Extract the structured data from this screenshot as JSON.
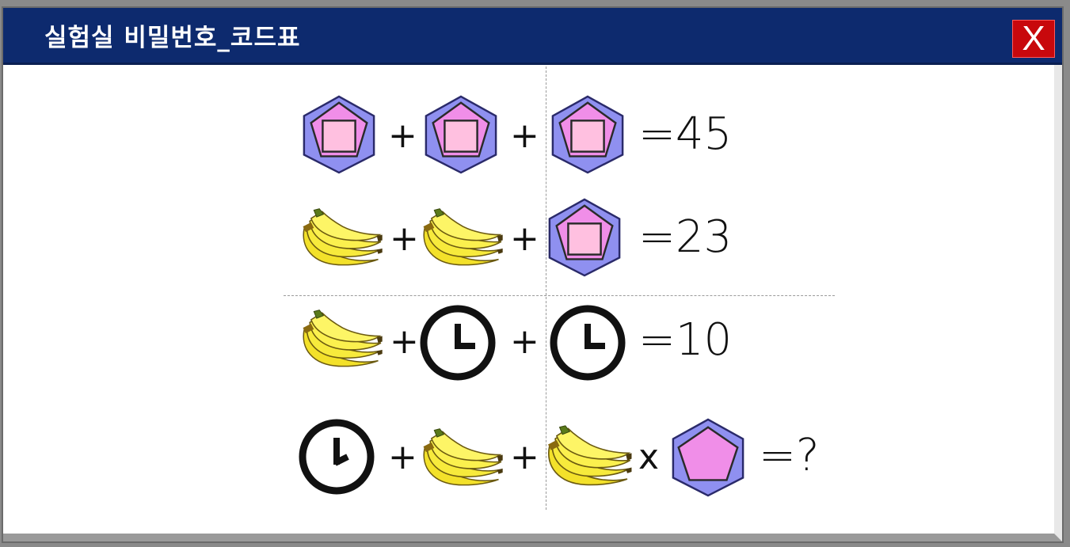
{
  "window": {
    "title": "실험실 비밀번호_코드표",
    "close_label": "X"
  },
  "colors": {
    "titlebar": "#0d2a6e",
    "close": "#c8080c",
    "hex_fill": "#8f90f0",
    "pentagon_fill": "#f08ee8",
    "square_fill": "#ffc0e0",
    "banana": "#f5e52a"
  },
  "puzzle": {
    "row1": {
      "op1": "+",
      "op2": "+",
      "result": "=45"
    },
    "row2": {
      "op1": "+",
      "op2": "+",
      "result": "=23"
    },
    "row3": {
      "op1": "+",
      "op2": "+",
      "result": "=10"
    },
    "row4": {
      "op1": "+",
      "op2": "+",
      "op3": "x",
      "result": "=?"
    }
  }
}
